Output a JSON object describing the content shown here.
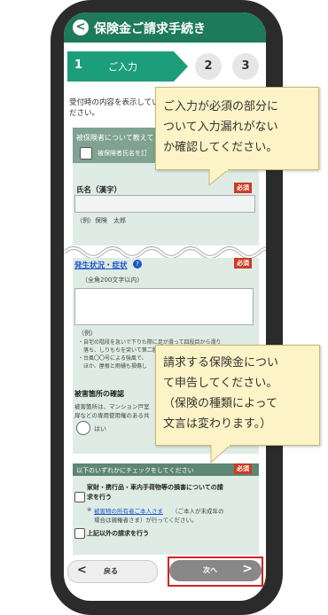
{
  "header": {
    "back": "<",
    "title": "保険金ご請求手続き"
  },
  "steps": {
    "current_num": "1",
    "current_label": "ご入力",
    "step2": "2",
    "step3": "3"
  },
  "intro": {
    "line1": "受付時の内容を表示してい",
    "line2": "ださい。"
  },
  "insured_section": {
    "title": "被保険者について教えて",
    "checkbox_label": "被保険者氏名を訂",
    "name_label": "氏名（漢字）",
    "required": "必須",
    "name_example": "（例）保険　太郎"
  },
  "situation_section": {
    "link": "発生状況・症状",
    "required": "必須",
    "limit": "（全角200文字以内）",
    "example_label": "（例）",
    "example1": "・自宅の階段を急いで下りた際に足が滑って四段目から滑り",
    "example2": "　落ち、しりもちを突いて第二腰椎を圧迫骨折した。",
    "example3": "・台風〇〇号による強風で、",
    "example4": "　ほか、屋根と雨樋も損傷し",
    "damage_label": "被害箇所の確認",
    "damage_note1": "被害箇所は、マンション戸室",
    "damage_note2": "扉などの専用使用権のある共",
    "radio_label": "はい"
  },
  "claim_section": {
    "title": "以下のいずれかにチェックをしてください",
    "required": "必須",
    "option1_line1": "家財・携行品・車内手荷物等の損害についての請",
    "option1_line2": "求を行う",
    "note_link": "被害物の所有者ご本人さま",
    "note1_rest": "（ご本人が未成年の",
    "note2": "場合は親権者さま）が行ってください。",
    "note_prefix": "※",
    "option2": "上記以外の請求を行う"
  },
  "buttons": {
    "back_icon": "<",
    "back": "戻る",
    "next": "次へ",
    "next_icon": ">"
  },
  "callouts": {
    "c1": [
      "ご入力が必須の部分に",
      "ついて入力漏れがない",
      "か確認してください。"
    ],
    "c2": [
      "請求する保険金につい",
      "て申告してください。",
      "（保険の種類によって",
      "文言は変わります。）"
    ]
  }
}
